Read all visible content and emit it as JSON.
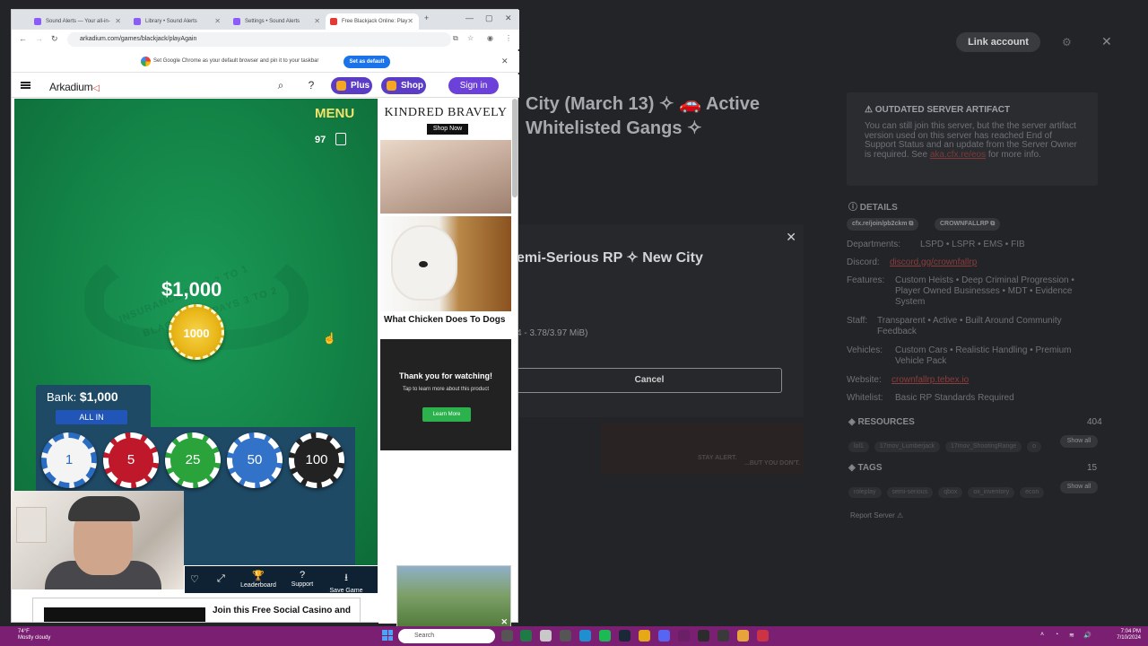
{
  "background_app": {
    "link_account": "Link account",
    "server_title": "City (March 13) ✧ 🚗 Active Whitelisted Gangs ✧",
    "warning": {
      "heading": "OUTDATED SERVER ARTIFACT",
      "text": "You can still join this server, but the the server artifact version used on this server has reached End of Support Status and an update from the Server Owner is required. See",
      "link": "aka.cfx.re/eos",
      "tail": "for more info."
    },
    "details_heading": "DETAILS",
    "pills": [
      "cfx.re/join/pb2ckm ⧉",
      "CROWNFALLRP ⧉"
    ],
    "rows": [
      {
        "label": "Departments:",
        "value": "LSPD • LSPR • EMS • FIB"
      },
      {
        "label": "Discord:",
        "value": "discord.gg/crownfallrp"
      },
      {
        "label": "Features:",
        "value": "Custom Heists • Deep Criminal Progression • Player Owned Businesses • MDT • Evidence System"
      },
      {
        "label": "Staff:",
        "value": "Transparent • Active • Built Around Community Feedback"
      },
      {
        "label": "Vehicles:",
        "value": "Custom Cars • Realistic Handling • Premium Vehicle Pack"
      },
      {
        "label": "Website:",
        "value": "crownfallrp.tebex.io"
      },
      {
        "label": "Whitelist:",
        "value": "Basic RP Standards Required"
      }
    ],
    "resources": {
      "heading": "RESOURCES",
      "count": "404",
      "tags": [
        "lol1",
        "17mov_Lumberjack",
        "17mov_ShootingRange",
        "o"
      ],
      "show_all": "Show all"
    },
    "tags": {
      "heading": "TAGS",
      "count": "15",
      "tags": [
        "roleplay",
        "semi-serious",
        "qbox",
        "ox_inventory",
        "econ"
      ],
      "show_all": "Show all"
    },
    "report": "Report Server ⚠",
    "modal": {
      "title": "emi-Serious RP ✧ New City",
      "size": "4 - 3.78/3.97 MiB)",
      "cancel": "Cancel"
    },
    "thumbs": [
      "STAY ALERT.",
      "...BUT YOU DON'T."
    ]
  },
  "browser": {
    "tabs": [
      {
        "label": "Sound Alerts — Your all-in-",
        "color": "#8b5cf6"
      },
      {
        "label": "Library • Sound Alerts",
        "color": "#8b5cf6"
      },
      {
        "label": "Settings • Sound Alerts",
        "color": "#8b5cf6"
      },
      {
        "label": "Free Blackjack Online: Play",
        "color": "#e53935"
      }
    ],
    "url": "arkadium.com/games/blackjack/playAgain",
    "infobar_msg": "Set Google Chrome as your default browser and pin it to your taskbar",
    "set_default": "Set as default"
  },
  "site": {
    "logo": "Arkadium",
    "plus": "Plus",
    "shop": "Shop",
    "signin": "Sign in"
  },
  "game": {
    "menu": "MENU",
    "deck_count": "97",
    "felt_line1": "INSURANCE PAYS 2 TO 1",
    "felt_line2": "BLACKJACK PAYS 3 TO 2",
    "bet_amount": "$1,000",
    "bet_chip": "1000",
    "bank_label": "Bank:",
    "bank_value": "$1,000",
    "all_in": "ALL IN",
    "chips": [
      {
        "value": "1",
        "color": "#f4f4f4"
      },
      {
        "value": "5",
        "color": "#c0182b"
      },
      {
        "value": "25",
        "color": "#2aa43a"
      },
      {
        "value": "50",
        "color": "#3273c9"
      },
      {
        "value": "100",
        "color": "#222222"
      }
    ],
    "footer": [
      {
        "label": "Leaderboard",
        "icon": "trophy-icon"
      },
      {
        "label": "Support",
        "icon": "help-icon"
      },
      {
        "label": "Save Game",
        "icon": "download-icon"
      }
    ],
    "banner": "Join this Free Social Casino and"
  },
  "ads": {
    "ad1_brand": "KINDRED BRAVELY",
    "ad1_button": "Shop Now",
    "ad2_caption": "What Chicken Does To Dogs",
    "ad3_title": "Thank you for watching!",
    "ad3_sub": "Tap to learn more about this product",
    "ad3_button": "Learn More"
  },
  "taskbar": {
    "weather_temp": "74°F",
    "weather_desc": "Mostly cloudy",
    "search": "Search",
    "time": "7:04 PM",
    "date": "7/10/2024"
  }
}
